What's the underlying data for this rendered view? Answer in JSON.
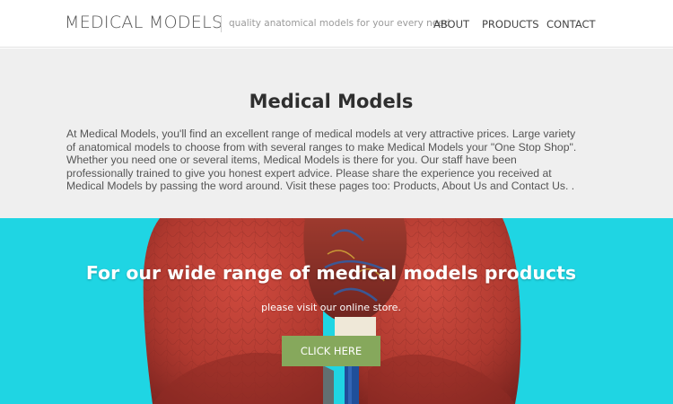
{
  "header": {
    "logo": "MEDICAL MODELS",
    "tagline": "quality anatomical models for your every need",
    "nav": {
      "about": "ABOUT",
      "products": "PRODUCTS",
      "contact": "CONTACT"
    }
  },
  "intro": {
    "title": "Medical Models",
    "body": "At Medical Models, you'll find an excellent range of medical models at very attractive prices. Large variety of anatomical models to choose from with several ranges to make Medical Models your \"One Stop Shop\". Whether you need one or several items, Medical Models is there for you. Our staff have been professionally trained to give you honest expert advice. Please share the experience you received at Medical Models by passing the word around. Visit these pages too: Products, About Us and Contact Us. ."
  },
  "hero": {
    "title": "For our wide range of medical models products",
    "subtitle": "please visit our online store.",
    "button_label": "CLICK HERE",
    "image_subject": "lungs-anatomical-model"
  },
  "colors": {
    "hero_background": "#1fd5e3",
    "intro_background": "#efefef",
    "button": "#86a85c",
    "lung_red": "#b83a31"
  }
}
